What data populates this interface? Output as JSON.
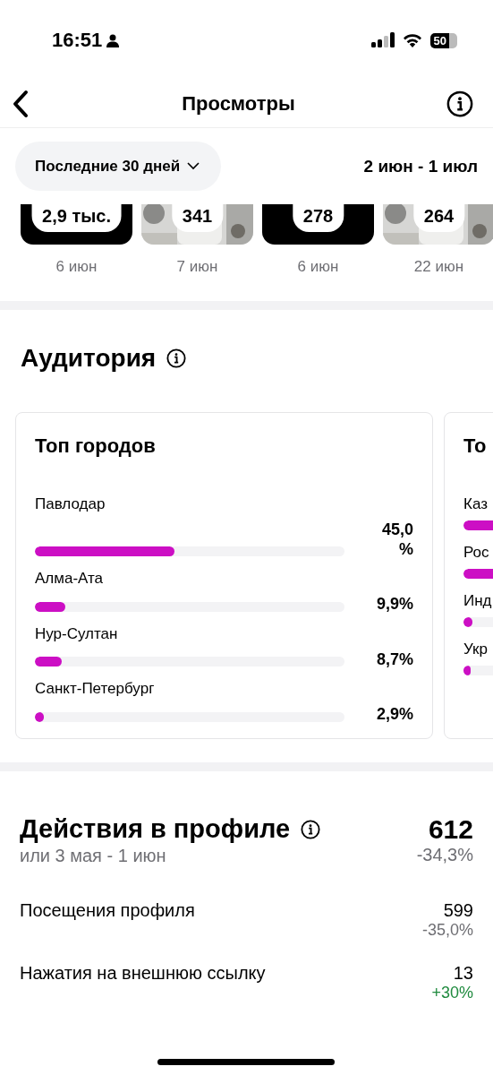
{
  "status_bar": {
    "time": "16:51",
    "battery": "50"
  },
  "header": {
    "title": "Просмотры"
  },
  "period": {
    "selector": "Последние 30 дней",
    "range": "2 июн - 1 июл"
  },
  "posts": [
    {
      "kind": "dark",
      "views": "2,9 тыс.",
      "date": "6 июн"
    },
    {
      "kind": "picture",
      "views": "341",
      "date": "7 июн"
    },
    {
      "kind": "dark",
      "views": "278",
      "date": "6 июн"
    },
    {
      "kind": "picture",
      "views": "264",
      "date": "22 июн"
    }
  ],
  "audience": {
    "title": "Аудитория",
    "cards": [
      {
        "title": "Топ городов",
        "items": [
          {
            "name": "Павлодар",
            "level": 0.45,
            "value": "45,0%"
          },
          {
            "name": "Алма-Ата",
            "level": 0.099,
            "value": "9,9%"
          },
          {
            "name": "Нур-Султан",
            "level": 0.087,
            "value": "8,7%"
          },
          {
            "name": "Санкт-Петербург",
            "level": 0.029,
            "value": "2,9%"
          }
        ]
      },
      {
        "title": "То",
        "items": [
          {
            "name": "Каз"
          },
          {
            "name": "Рос"
          },
          {
            "name": "Инд",
            "level": 0.03
          },
          {
            "name": "Укр",
            "level": 0.012
          }
        ]
      }
    ]
  },
  "profile_actions": {
    "title": "Действия в профиле",
    "subtitle": "или 3 мая - 1 июн",
    "total": "612",
    "change": "-34,3%",
    "color": "#6e6e73",
    "rows": [
      {
        "label": "Посещения профиля",
        "value": "599",
        "change": "-35,0%",
        "color": "#6e6e73"
      },
      {
        "label": "Нажатия на внешнюю ссылку",
        "value": "13",
        "change": "+30%",
        "color": "#1f8a3e"
      }
    ]
  }
}
